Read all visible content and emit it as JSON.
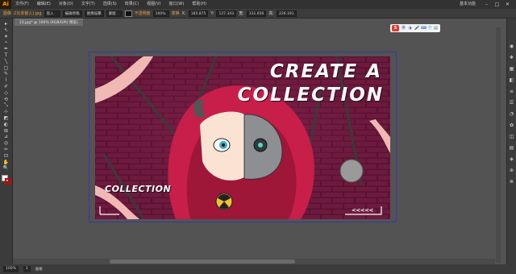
{
  "app": {
    "logo": "Ai"
  },
  "menubar": {
    "items": [
      "文件(F)",
      "编辑(E)",
      "对象(O)",
      "文字(T)",
      "选择(S)",
      "效果(C)",
      "视图(V)",
      "窗口(W)",
      "帮助(H)"
    ],
    "right_label": "基本功能",
    "window_controls": [
      "–",
      "□",
      "✕"
    ]
  },
  "control_bar": {
    "label": "图像",
    "file_name": "23(未嵌入).jpg",
    "embed_button": "嵌入",
    "edit_button": "编辑原稿",
    "trace_button": "图像描摹",
    "mask_button": "蒙版",
    "opacity_label": "不透明度",
    "opacity_value": "100%",
    "transform_label": "变换",
    "x_label": "X:",
    "x_value": "185.875",
    "y_label": "Y:",
    "y_value": "127.343",
    "w_label": "宽:",
    "w_value": "331.656",
    "h_label": "高:",
    "h_value": "226.191"
  },
  "document_tab": {
    "title": "23.jpg* @ 100% (RGB/GPU 预览)"
  },
  "ime_bar": {
    "logo": "S",
    "icons": [
      "英",
      "◑",
      "🎤",
      "⌨",
      "👕",
      "▤"
    ]
  },
  "toolbar": {
    "tools": [
      "▸",
      "↖",
      "✦",
      "⌁",
      "✒",
      "T",
      "╲",
      "□",
      "✎",
      "⌇",
      "✐",
      "◇",
      "⟲",
      "⤡",
      "⊹",
      "◩",
      "◐",
      "⊞",
      "⊿",
      "◎",
      "✂",
      "⊡",
      "✋",
      "🔍"
    ]
  },
  "right_panel": {
    "icons": [
      "◉",
      "❖",
      "▦",
      "◧",
      "≡",
      "☰",
      "◔",
      "✿",
      "◫",
      "▤",
      "◈",
      "⊕",
      "⊗"
    ]
  },
  "artwork": {
    "title_line1": "CREATE A",
    "title_line2": "COLLECTION",
    "subtitle": "COLLECTION",
    "arrows": "<<<<<"
  },
  "status_bar": {
    "zoom": "100%",
    "page": "1",
    "info": "画板"
  },
  "colors": {
    "accent": "#ff9a00",
    "artwork_bg": "#5e1436",
    "hood": "#c81e4a",
    "brick": "#7a1f45"
  }
}
